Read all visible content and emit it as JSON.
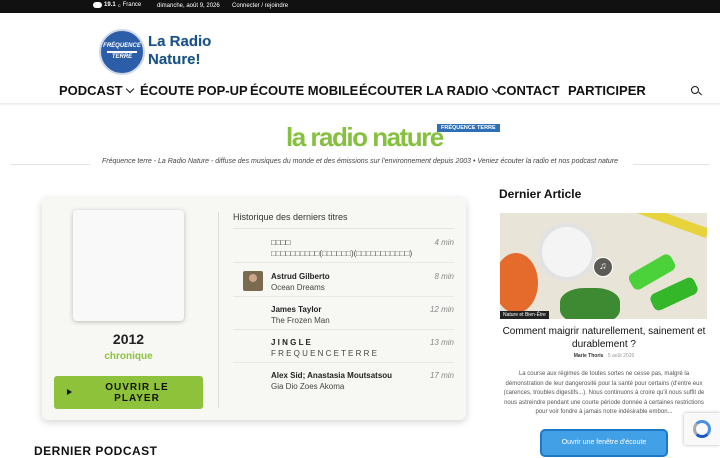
{
  "topbar": {
    "temperature": "19.1",
    "unit": "C",
    "location": "France",
    "date": "dimanche, août 9, 2026",
    "login": "Connecter / rejoindre"
  },
  "logo": {
    "badge_line1": "FRÉQUENCE",
    "badge_line2": "TERRE",
    "wordmark": "La Radio Nature!"
  },
  "nav": {
    "items": [
      {
        "label": "PODCAST",
        "has_dropdown": true
      },
      {
        "label": "ÉCOUTE POP-UP",
        "has_dropdown": false
      },
      {
        "label": "ÉCOUTE MOBILE",
        "has_dropdown": false
      },
      {
        "label": "ÉCOUTER LA RADIO",
        "has_dropdown": true
      },
      {
        "label": "CONTACT",
        "has_dropdown": false
      },
      {
        "label": "PARTICIPER",
        "has_dropdown": false
      }
    ],
    "search_icon": "search-icon"
  },
  "brand": {
    "title": "la radio nature",
    "tag": "FRÉQUENCE TERRE",
    "tagline": "Fréquence terre - La Radio Nature - diffuse des musiques du monde et des émissions sur l'environnement depuis 2003 • Veniez écouter la radio et nos podcast nature"
  },
  "player": {
    "year": "2012",
    "subtitle": "chronique",
    "listen_label": "OUVRIR LE PLAYER",
    "history_title": "Historique des derniers titres",
    "tracks": [
      {
        "artist": "□□□□",
        "title": "□□□□□□□□□□(□□□□□□)(□□□□□□□□□□□)",
        "duration": "4 min",
        "has_thumb": false
      },
      {
        "artist": "Astrud Gilberto",
        "title": "Ocean Dreams",
        "duration": "8 min",
        "has_thumb": true
      },
      {
        "artist": "James Taylor",
        "title": "The Frozen Man",
        "duration": "12 min",
        "has_thumb": false
      },
      {
        "artist": "J I N G L E",
        "title": "F R E Q U E N C E T E R R E",
        "duration": "13 min",
        "has_thumb": false
      },
      {
        "artist": "Alex Sid; Anastasia Moutsatsou",
        "title": "Gia Dio Zoes Akoma",
        "duration": "17 min",
        "has_thumb": false
      }
    ]
  },
  "sidebar": {
    "title": "Dernier Article",
    "article": {
      "category": "Nature et Bien-Être",
      "headline": "Comment maigrir naturellement, sainement et durablement ?",
      "author": "Marie Thoris",
      "date": "5 août 2026",
      "excerpt": "La course aux régimes de toutes sortes ne cesse pas, malgré la démonstration de leur dangerosité pour la santé pour certains (d'entre eux (carences, troubles digestifs...). Nous continuons à croire qu'il nous suffit de nous astreindre pendant une courte période donnée à certaines restrictions pour voir fondre à jamais notre indésirable embon..."
    },
    "window_button": "Ouvrir une fenêtre d'écoute"
  },
  "bottom": {
    "heading": "DERNIER PODCAST"
  },
  "colors": {
    "accent_green": "#8ec23b",
    "brand_blue": "#2e6fb5",
    "topbar": "#111111"
  }
}
